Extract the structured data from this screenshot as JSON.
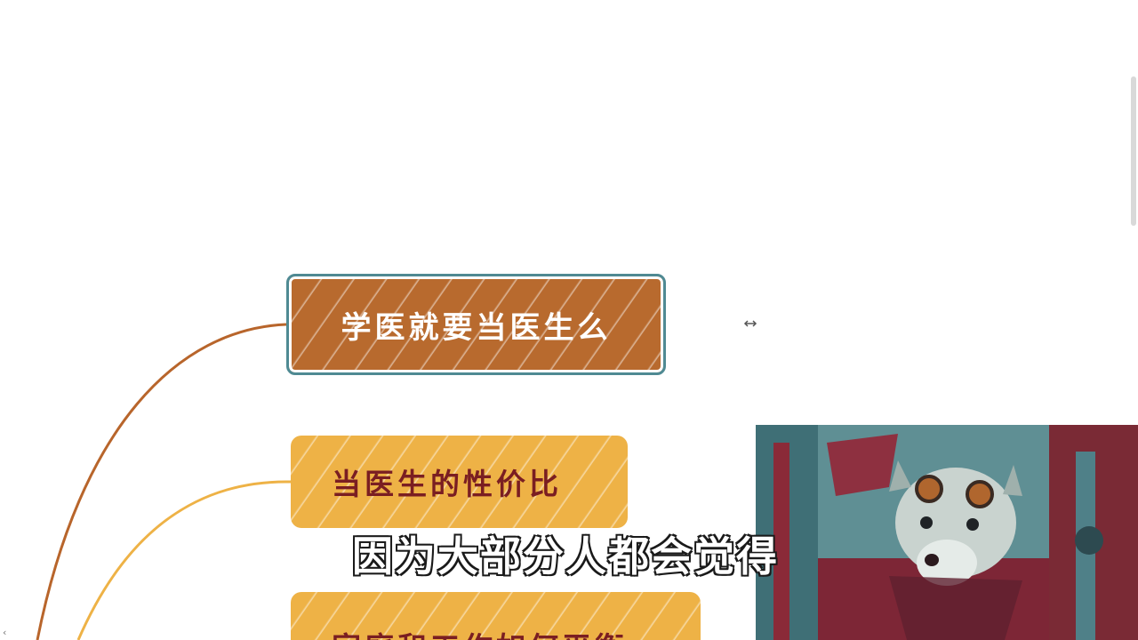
{
  "mindmap": {
    "root": {
      "label": "学医就要当医生么"
    },
    "children": [
      {
        "label": "当医生的性价比"
      },
      {
        "label": "家庭和工作如何平衡"
      }
    ]
  },
  "subtitle": {
    "text": "因为大部分人都会觉得"
  },
  "colors": {
    "root_fill": "#b86a2e",
    "root_border": "#4f8a93",
    "child_fill": "#eeb246",
    "child_text": "#7a1e22",
    "root_branch": "#b8652b",
    "child_branch": "#eeb246"
  },
  "icons": {
    "link_cursor": "resize-horizontal-cursor-icon",
    "scroll_left": "chevron-left-icon"
  }
}
